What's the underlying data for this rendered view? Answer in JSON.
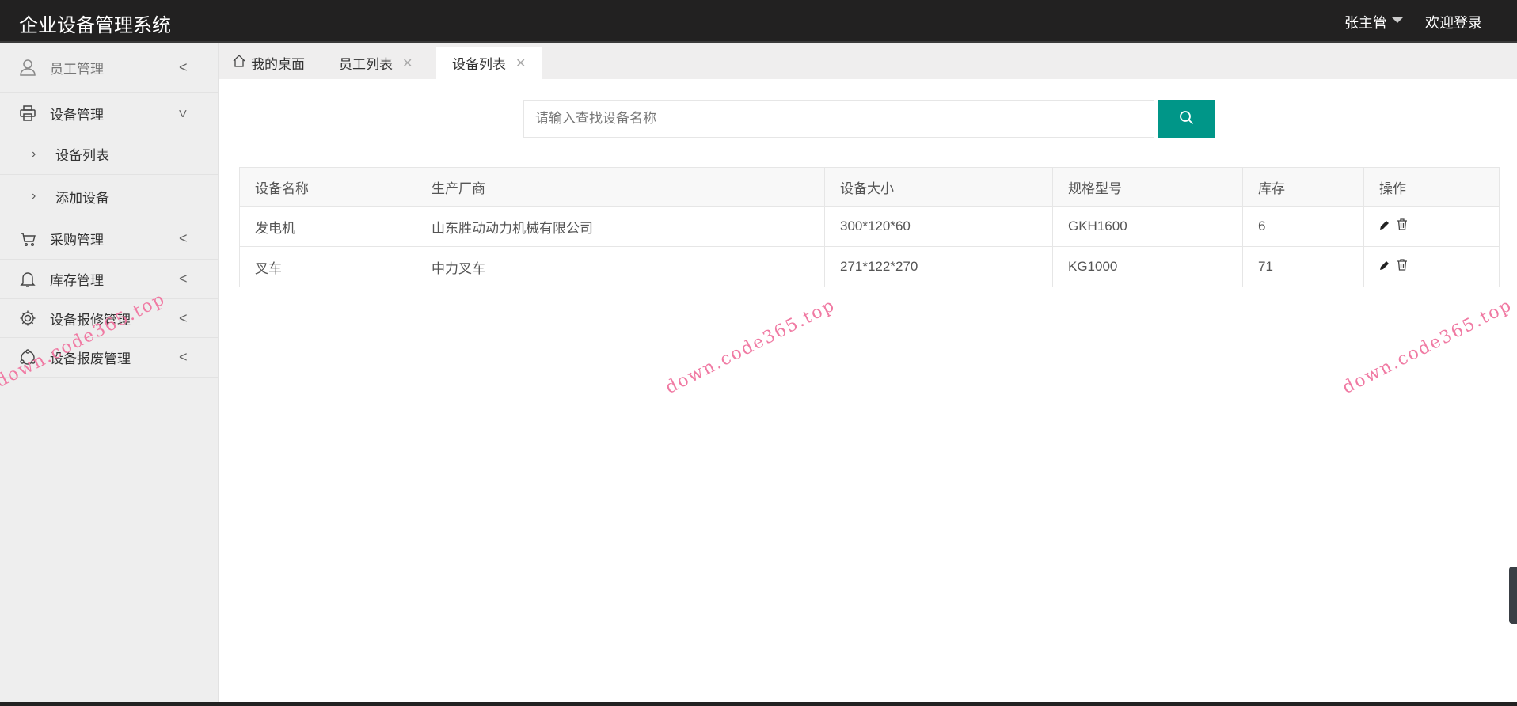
{
  "header": {
    "title": "企业设备管理系统",
    "user": "张主管",
    "welcome": "欢迎登录"
  },
  "sidebar": {
    "items": [
      {
        "label": "员工管理",
        "icon": "user-icon"
      },
      {
        "label": "设备管理",
        "icon": "printer-icon"
      },
      {
        "label": "设备列表"
      },
      {
        "label": "添加设备"
      },
      {
        "label": "采购管理",
        "icon": "cart-icon"
      },
      {
        "label": "库存管理",
        "icon": "bell-icon"
      },
      {
        "label": "设备报修管理",
        "icon": "gear-icon"
      },
      {
        "label": "设备报废管理",
        "icon": "share-icon"
      }
    ]
  },
  "tabs": [
    {
      "label": "我的桌面"
    },
    {
      "label": "员工列表"
    },
    {
      "label": "设备列表"
    }
  ],
  "search": {
    "placeholder": "请输入查找设备名称",
    "value": ""
  },
  "table": {
    "columns": [
      "设备名称",
      "生产厂商",
      "设备大小",
      "规格型号",
      "库存",
      "操作"
    ],
    "rows": [
      [
        "发电机",
        "山东胜动动力机械有限公司",
        "300*120*60",
        "GKH1600",
        "6"
      ],
      [
        "叉车",
        "中力叉车",
        "271*122*270",
        "KG1000",
        "71"
      ]
    ]
  },
  "watermark": "down.code365.top",
  "colors": {
    "accent": "#009688",
    "header": "#222121"
  }
}
